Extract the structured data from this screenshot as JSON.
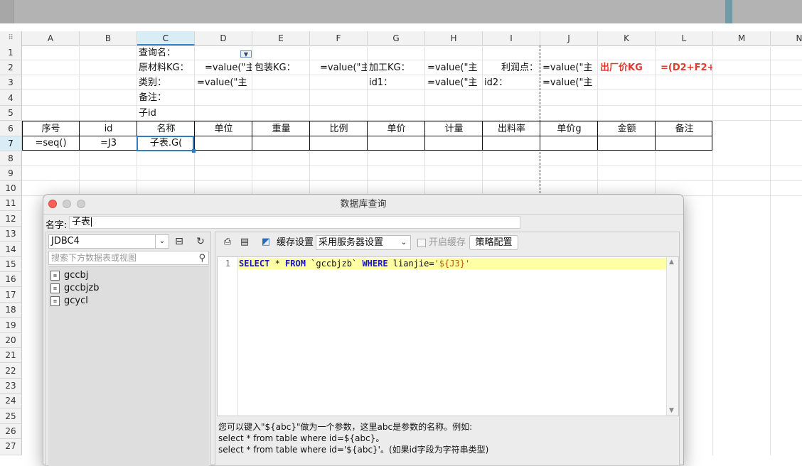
{
  "columns": [
    "A",
    "B",
    "C",
    "D",
    "E",
    "F",
    "G",
    "H",
    "I",
    "J",
    "K",
    "L",
    "M",
    "N"
  ],
  "rows": [
    "1",
    "2",
    "3",
    "4",
    "5",
    "6",
    "7",
    "8",
    "9",
    "10",
    "11",
    "12",
    "13",
    "14",
    "15",
    "16",
    "17",
    "18",
    "19",
    "20",
    "21",
    "22",
    "23",
    "24",
    "25",
    "26",
    "27"
  ],
  "cells": {
    "c1": "查询名：",
    "c2": "原材料KG：",
    "d2": "=value(\"主",
    "e2": "包装KG：",
    "f2": "=value(\"主",
    "g2": "加工KG：",
    "h2": "=value(\"主",
    "i2": "利润点：",
    "j2": "=value(\"主",
    "k2": "出厂价KG",
    "l2": "=(D2+F2+",
    "c3": "类别：",
    "d3": "=value(\"主",
    "g3": "id1：",
    "h3": "=value(\"主",
    "i3": "id2：",
    "j3": "=value(\"主",
    "c4": "备注：",
    "c5": "子id"
  },
  "table_headers": [
    "序号",
    "id",
    "名称",
    "单位",
    "重量",
    "比例",
    "单价",
    "计量",
    "出料率",
    "单价g",
    "金额",
    "备注"
  ],
  "table_row7": {
    "a7": "=seq()",
    "b7": "=J3",
    "c7": "子表.G("
  },
  "colors": {
    "accent_red": "#e03a2f",
    "selection_blue": "#2f7ec3"
  },
  "dialog": {
    "title": "数据库查询",
    "name_label": "名字:",
    "name_value": "子表",
    "datasource": "JDBC4",
    "search_placeholder": "搜索下方数据表或视图",
    "tables": [
      "gccbj",
      "gccbjzb",
      "gcycl"
    ],
    "cache_label": "缓存设置",
    "cache_option": "采用服务器设置",
    "enable_cache_label": "开启缓存",
    "policy_button": "策略配置",
    "sql_line_number": "1",
    "sql": {
      "kw1": "SELECT",
      "star": " * ",
      "kw2": "FROM",
      "table": " `gccbjzb` ",
      "kw3": "WHERE",
      "cond": " lianjie=",
      "param": "'${J3}'"
    },
    "help_lines": [
      "您可以键入\"${abc}\"做为一个参数，这里abc是参数的名称。例如:",
      "select * from table where id=${abc}。",
      "select * from table where id='${abc}'。(如果id字段为字符串类型)"
    ]
  }
}
